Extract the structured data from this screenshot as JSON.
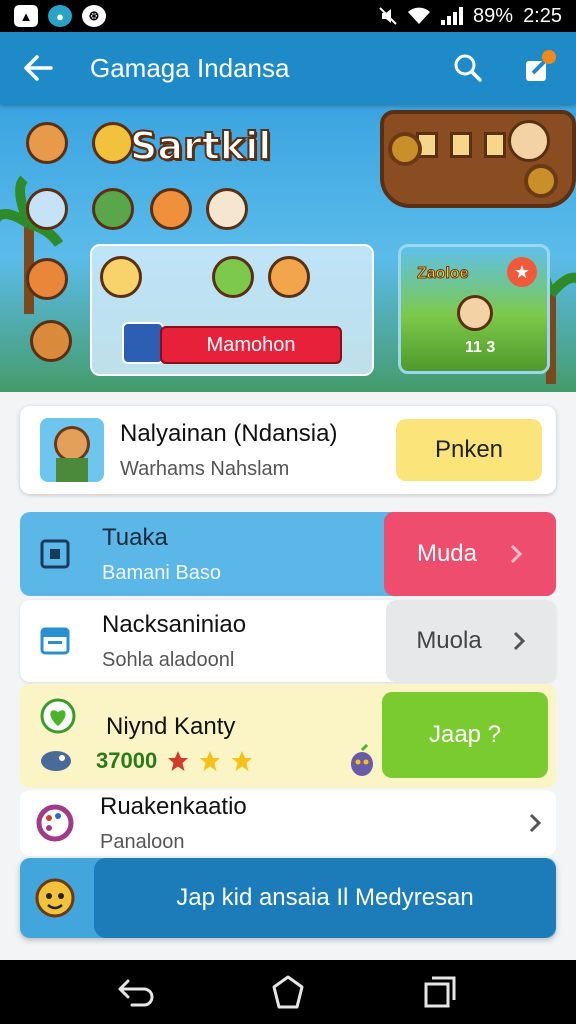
{
  "status_bar": {
    "battery": "89%",
    "time": "2:25"
  },
  "app_bar": {
    "title": "Gamaga Indansa"
  },
  "banner": {
    "brand": "Sartkil",
    "badge": "Mamohon",
    "game_card_title": "Zaoloe",
    "game_card_score": "11 3"
  },
  "rows": [
    {
      "title": "Nalyainan (Ndansia)",
      "subtitle": "Warhams Nahslam",
      "button": "Pnken"
    },
    {
      "title": "Tuaka",
      "subtitle": "Bamani Baso",
      "button": "Muda"
    },
    {
      "title": "Nacksaniniao",
      "subtitle": "Sohla aladoonl",
      "button": "Muola"
    },
    {
      "title": "Niynd Kanty",
      "score": "37000",
      "button": "Jaap ?"
    },
    {
      "title": "Ruakenkaatio",
      "subtitle": "Panaloon"
    },
    {
      "button": "Jap kid ansaia Il Medyresan"
    }
  ],
  "colors": {
    "app_bar": "#1f8ac8",
    "row_blue": "#5ab7e8",
    "pink_button": "#ef4d6e",
    "green_button": "#7acb30",
    "yellow_button": "#fbe47a",
    "cta": "#1c7bb9"
  },
  "icons": [
    "back-arrow-icon",
    "search-icon",
    "share-icon",
    "home-icon",
    "recents-icon"
  ]
}
